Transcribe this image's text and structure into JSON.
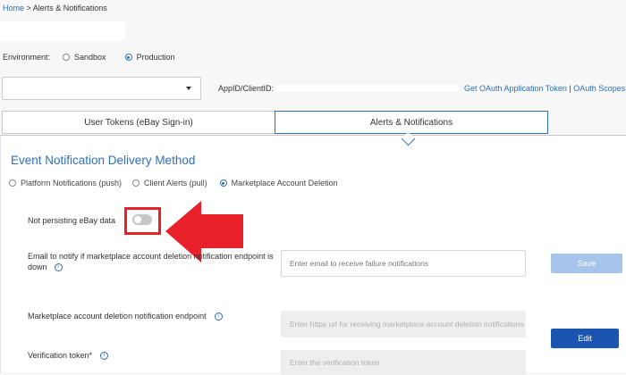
{
  "breadcrumb": {
    "home": "Home",
    "separator": " > ",
    "current": "Alerts & Notifications"
  },
  "environment": {
    "label": "Environment:",
    "options": [
      {
        "label": "Sandbox",
        "selected": false
      },
      {
        "label": "Production",
        "selected": true
      }
    ]
  },
  "app": {
    "appid_label": "AppID/ClientID:",
    "get_token_link": "Get OAuth Application Token",
    "link_separator": " | ",
    "scopes_link": "OAuth Scopes"
  },
  "tabs": [
    {
      "label": "User Tokens (eBay Sign-in)",
      "active": false
    },
    {
      "label": "Alerts & Notifications",
      "active": true
    }
  ],
  "section": {
    "title": "Event Notification Delivery Method",
    "methods": [
      {
        "label": "Platform Notifications (push)",
        "selected": false
      },
      {
        "label": "Client Alerts (pull)",
        "selected": false
      },
      {
        "label": "Marketplace Account Deletion",
        "selected": true
      }
    ]
  },
  "form": {
    "not_persisting_label": "Not persisting eBay data",
    "not_persisting_on": false,
    "email_label_line1": "Email to notify if marketplace account deletion notification endpoint is",
    "email_label_line2": "down",
    "email_placeholder": "Enter email to receive failure notifications",
    "save_label": "Save",
    "endpoint_label": "Marketplace account deletion notification endpoint",
    "endpoint_placeholder": "Enter https url for receiving marketplace account deletion notifications",
    "token_label": "Verification token",
    "token_required_mark": "*",
    "token_placeholder": "Enter the verification token",
    "edit_label": "Edit",
    "info_glyph": "i"
  },
  "colors": {
    "link": "#2f6fb5",
    "highlight": "#e8202a",
    "primary_button": "#1b55b0",
    "disabled_button": "#a7c4ea"
  },
  "icons": {
    "select": "chevron-down-icon",
    "info": "info-icon",
    "annotation": "red-arrow-left-icon"
  }
}
